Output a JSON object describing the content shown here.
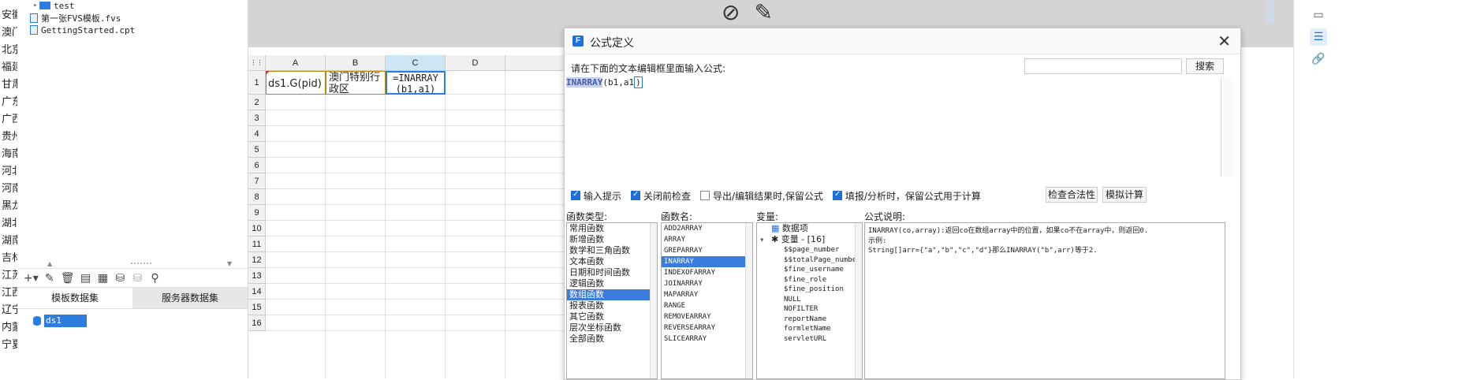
{
  "provinces": [
    "安徽",
    "澳门",
    "北京",
    "福建",
    "甘肃",
    "广东",
    "广西",
    "贵州",
    "海南",
    "河北",
    "河南",
    "黑龙",
    "湖北",
    "湖南",
    "吉林",
    "江苏",
    "江西",
    "辽宁",
    "内蒙",
    "宁夏"
  ],
  "file_tree": [
    {
      "type": "folder",
      "label": "test",
      "indent": 1
    },
    {
      "type": "file",
      "label": "第一张FVS模板.fvs",
      "indent": 0
    },
    {
      "type": "file",
      "label": "GettingStarted.cpt",
      "indent": 0
    }
  ],
  "dataset_tabs": {
    "template": "模板数据集",
    "server": "服务器数据集"
  },
  "dataset_item": "ds1",
  "sheet": {
    "columns": [
      "A",
      "B",
      "C",
      "D"
    ],
    "rows": [
      "1",
      "2",
      "3",
      "4",
      "5",
      "6",
      "7",
      "8",
      "9",
      "10",
      "11",
      "12",
      "13",
      "14",
      "15",
      "16"
    ],
    "cells": {
      "A1": "ds1.G(pid)",
      "B1": "澳门特别行政区",
      "C1": "=INARRAY(b1,a1)"
    }
  },
  "dialog": {
    "title": "公式定义",
    "prompt": "请在下面的文本编辑框里面输入公式:",
    "search_placeholder": "",
    "search_button": "搜索",
    "formula_fn": "INARRAY",
    "formula_args": "(b1,a1",
    "formula_close": ")",
    "options": [
      {
        "label": "输入提示",
        "checked": true
      },
      {
        "label": "关闭前检查",
        "checked": true
      },
      {
        "label": "导出/编辑结果时,保留公式",
        "checked": false
      },
      {
        "label": "填报/分析时，保留公式用于计算",
        "checked": true
      }
    ],
    "check_button": "检查合法性",
    "simulate_button": "模拟计算",
    "labels": {
      "categories": "函数类型:",
      "functions": "函数名:",
      "variables": "变量:",
      "description": "公式说明:"
    },
    "categories": [
      "常用函数",
      "新增函数",
      "数学和三角函数",
      "文本函数",
      "日期和时间函数",
      "逻辑函数",
      "数组函数",
      "报表函数",
      "其它函数",
      "层次坐标函数",
      "全部函数"
    ],
    "selected_category": "数组函数",
    "functions": [
      "ADD2ARRAY",
      "ARRAY",
      "GREPARRAY",
      "INARRAY",
      "INDEXOFARRAY",
      "JOINARRAY",
      "MAPARRAY",
      "RANGE",
      "REMOVEARRAY",
      "REVERSEARRAY",
      "SLICEARRAY"
    ],
    "selected_function": "INARRAY",
    "variable_roots": [
      {
        "label": "数据项"
      },
      {
        "label": "变量 - [16]"
      }
    ],
    "variables": [
      "$$page_number",
      "$$totalPage_number",
      "$fine_username",
      "$fine_role",
      "$fine_position",
      "NULL",
      "NOFILTER",
      "reportName",
      "formletName",
      "servletURL"
    ],
    "description": {
      "line1": "INARRAY(co,array):返回co在数组array中的位置，如果co不在array中，则返回0.",
      "line2": "示例:",
      "line3": "String[]arr={\"a\",\"b\",\"c\",\"d\"}那么INARRAY(\"b\",arr)等于2."
    }
  },
  "colors": {
    "accent": "#1e6fd9",
    "selection": "#3a7be0",
    "canvas_grey": "#d4d4d4"
  }
}
